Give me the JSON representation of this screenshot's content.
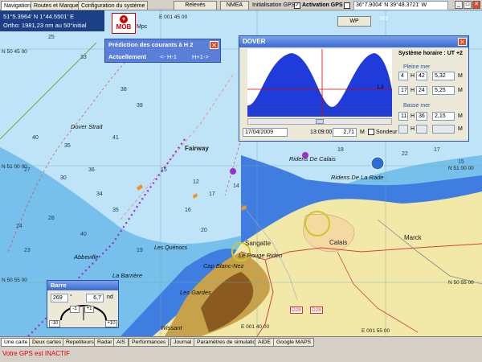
{
  "top_tabs": [
    "Navigation",
    "Routes et Marques",
    "Configuration du système"
  ],
  "top_buttons": {
    "releves": "Relevés",
    "nmea": "NMEA",
    "init_gps": "Initialisation GPS",
    "activation_gps": "Activation GPS",
    "coords": "36°7.9004' N 39°48.3721' W"
  },
  "position": {
    "line1": "51°5.3964' N  1°44.5501' E",
    "line2": "Ortho: 1981,23 nm au 50°initial"
  },
  "mob": {
    "label": "MOB"
  },
  "currents": {
    "title": "Prédiction des courants à H 2",
    "now": "Actuellement",
    "prev": "<- H-1",
    "next": "H+1->"
  },
  "dover": {
    "title": "DOVER",
    "system_time": "Système horaire : UT +2",
    "pleine_mer": "Pleine mer",
    "basse_mer": "Basse mer",
    "high_rows": [
      {
        "d": "4",
        "h": "H",
        "t": "42",
        "v": "5,32",
        "u": "M"
      },
      {
        "d": "17",
        "h": "H",
        "t": "24",
        "v": "5,25",
        "u": "M"
      }
    ],
    "low_rows": [
      {
        "d": "11",
        "h": "H",
        "t": "36",
        "v": "2,15",
        "u": "M"
      },
      {
        "d": "",
        "h": "H",
        "t": "",
        "v": "",
        "u": "M"
      }
    ],
    "date": "17/04/2009",
    "time": "13:09:00",
    "height": "2,71",
    "unit": "M",
    "sondeur": "Sondeur",
    "wp": "WP",
    "m3": "M3",
    "curve_label": "1,3"
  },
  "barre": {
    "title": "Barre",
    "heading": "269",
    "deg": "°",
    "val": "6,7",
    "nd": "nd",
    "minus10": "-10",
    "minus1": "-1",
    "plus1": "+1",
    "plus10": "+10"
  },
  "map_labels": {
    "dover_strait": "Dover Strait",
    "fairway": "Fairway",
    "ridens_calais": "Ridens De Calais",
    "ridens_rade": "Ridens De La Rade",
    "sangatte": "Sangatte",
    "calais": "Calais",
    "marck": "Marck",
    "abbeville": "Abbeville",
    "barriere": "La Barrière",
    "rouge_riden": "Le Rouge Riden",
    "cap_blanc": "Cap Blanc-Nez",
    "quenocs": "Les Quénocs",
    "gardes": "Les Gardes",
    "wissant": "Wissant",
    "les_quenocs": "Les Quénocs",
    "lat_n5045": "N 50 45 00",
    "lat_n5100": "N 51 00 00",
    "lat_n5055": "N 50 55 00",
    "lat_n5050": "N 50 50 00",
    "lat_r5055": "N 50 55 00",
    "lat_r5050": "N 50 50 00",
    "lat_r5100": "N 51 00 00",
    "lon_e00145": "E 001 45 00",
    "lon_e00140": "E 001 40 00",
    "lon_e00155": "E 001 55 00",
    "lon_e00150": "E 001 50 00",
    "mpc": "Mpc",
    "d28": "D28",
    "d28b": "D28",
    "d244": "D244"
  },
  "bottom_tabs": [
    "Une carte",
    "Deux cartes",
    "Repetiteurs",
    "Radar",
    "AIS",
    "Performances",
    "Journal",
    "Paramètres de simulation",
    "AIDE",
    "Google MAPS"
  ],
  "status": "Votre GPS est INACTIF",
  "colors": {
    "deep_water": "#bfe3f7",
    "mid_water": "#77c0ec",
    "shallow_water": "#3f7ee0",
    "land": "#f2e8a8",
    "titlebar": "#3a6ad4",
    "tide_fill": "#1f3bd9"
  }
}
